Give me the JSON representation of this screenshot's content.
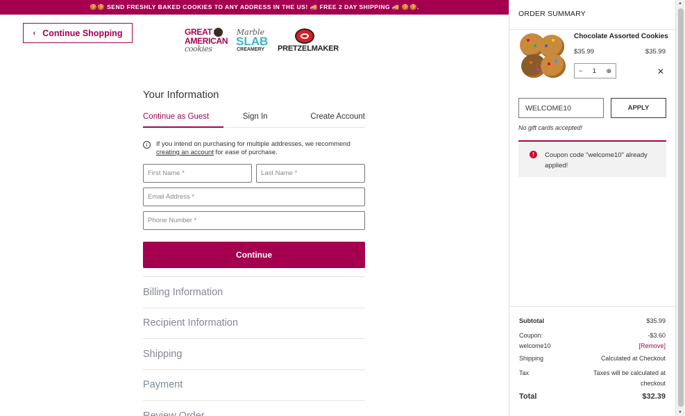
{
  "banner": {
    "text": "🍪🍪 SEND FRESHLY BAKED COOKIES TO ANY ADDRESS IN THE US! 🚚 FREE 2 DAY SHIPPING 🚚 🍪🍪."
  },
  "nav": {
    "back_label": "Continue Shopping"
  },
  "logos": {
    "gac": [
      "GREAT",
      "AMERICAN",
      "cookies"
    ],
    "marble_slab": [
      "Marble",
      "SLAB",
      "CREAMERY"
    ],
    "pretzelmaker": "PRETZELMAKER"
  },
  "form": {
    "title": "Your Information",
    "tabs": [
      "Continue as Guest",
      "Sign In",
      "Create Account"
    ],
    "note_prefix": "If you intend on purchasing for multiple addresses, we recommend",
    "note_link": "creating an account",
    "note_suffix": " for ease of purchase.",
    "first_name_placeholder": "First Name *",
    "last_name_placeholder": "Last Name *",
    "email_placeholder": "Email Address *",
    "phone_placeholder": "Phone Number *",
    "continue_label": "Continue",
    "sections": [
      "Billing Information",
      "Recipient Information",
      "Shipping",
      "Payment",
      "Review Order"
    ]
  },
  "sidebar": {
    "title": "ORDER SUMMARY",
    "product": {
      "name": "Chocolate Assorted Cookies",
      "price": "$35.99",
      "total": "$35.99",
      "qty": "1",
      "minus": "−",
      "plus": "⊕",
      "remove": "✕"
    },
    "coupon_value": "WELCOME10",
    "apply_label": "APPLY",
    "gift_note": "No gift cards accepted!",
    "alert": "Coupon code \"welcome10\" already applied!",
    "summary": {
      "subtotal_label": "Subtotal",
      "subtotal": "$35.99",
      "coupon_label": "Coupon:",
      "coupon_code": "welcome10",
      "coupon_amount": "-$3.60",
      "remove_label": "[Remove]",
      "shipping_label": "Shipping",
      "shipping_value": "Calculated at Checkout",
      "tax_label": "Tax",
      "tax_value": "Taxes will be calculated at checkout",
      "total_label": "Total",
      "total": "$32.39"
    }
  },
  "colors": {
    "brand": "#a50050",
    "muted_section": "#7f8a94",
    "alert_icon": "#c8102e"
  }
}
